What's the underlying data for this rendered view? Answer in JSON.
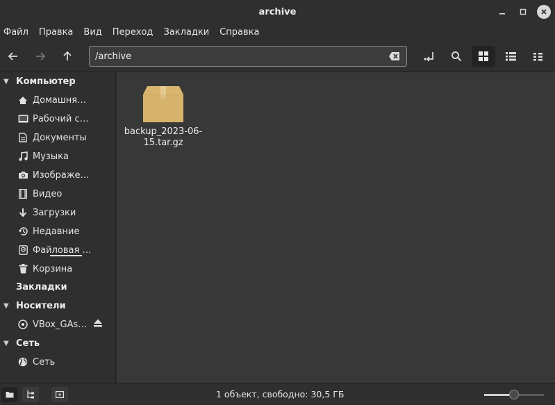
{
  "window": {
    "title": "archive",
    "buttons": [
      "minimize",
      "maximize",
      "close"
    ]
  },
  "menu": {
    "items": [
      {
        "label": "Файл"
      },
      {
        "label": "Правка"
      },
      {
        "label": "Вид"
      },
      {
        "label": "Переход"
      },
      {
        "label": "Закладки"
      },
      {
        "label": "Справка"
      }
    ]
  },
  "toolbar": {
    "path_value": "/archive",
    "view_mode": "icons"
  },
  "sidebar": {
    "sections": [
      {
        "label": "Компьютер",
        "expanded": true,
        "items": [
          {
            "label": "Домашня…",
            "icon": "home-icon"
          },
          {
            "label": "Рабочий с…",
            "icon": "desktop-icon"
          },
          {
            "label": "Документы",
            "icon": "documents-icon"
          },
          {
            "label": "Музыка",
            "icon": "music-icon"
          },
          {
            "label": "Изображе…",
            "icon": "camera-icon"
          },
          {
            "label": "Видео",
            "icon": "film-icon"
          },
          {
            "label": "Загрузки",
            "icon": "download-icon"
          },
          {
            "label": "Недавние",
            "icon": "recent-icon"
          },
          {
            "label": "Файловая …",
            "icon": "drive-icon",
            "usage_fraction": 0.6
          },
          {
            "label": "Корзина",
            "icon": "trash-icon"
          }
        ]
      },
      {
        "label": "Закладки",
        "expanded": false,
        "items": []
      },
      {
        "label": "Носители",
        "expanded": true,
        "items": [
          {
            "label": "VBox_GAs…",
            "icon": "optical-disc-icon",
            "eject": true
          }
        ]
      },
      {
        "label": "Сеть",
        "expanded": true,
        "items": [
          {
            "label": "Сеть",
            "icon": "network-icon"
          }
        ]
      }
    ]
  },
  "content": {
    "files": [
      {
        "name": "backup_2023-06-15.tar.gz",
        "icon": "archive-package-icon"
      }
    ]
  },
  "status": {
    "text": "1 объект, свободно: 30,5 ГБ",
    "zoom_fraction": 0.5
  },
  "colors": {
    "window_bg": "#2f2f2f",
    "content_bg": "#383838",
    "package": "#d9b670"
  }
}
